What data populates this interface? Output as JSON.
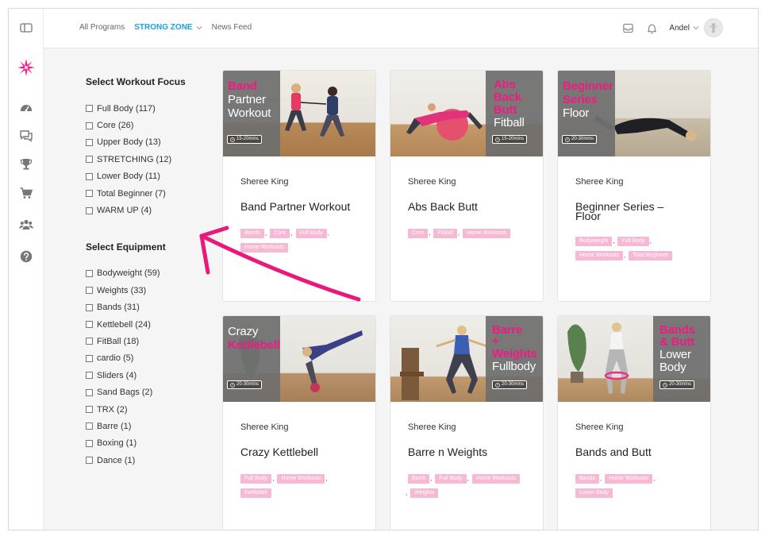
{
  "nav": {
    "all_programs": "All Programs",
    "strong_zone": "STRONG ZONE",
    "news_feed": "News Feed",
    "user_name": "Andel"
  },
  "sidebar": {
    "icons": [
      "sidebar-toggle-icon",
      "brand-logo",
      "dashboard-icon",
      "chat-icon",
      "trophy-icon",
      "cart-icon",
      "group-icon",
      "help-icon"
    ]
  },
  "filters": {
    "focus_title": "Select Workout Focus",
    "focus": [
      "Full Body (117)",
      "Core (26)",
      "Upper Body (13)",
      "STRETCHING (12)",
      "Lower Body (11)",
      "Total Beginner (7)",
      "WARM UP (4)"
    ],
    "equipment_title": "Select Equipment",
    "equipment": [
      "Bodyweight (59)",
      "Weights (33)",
      "Bands (31)",
      "Kettlebell (24)",
      "FitBall (18)",
      "cardio (5)",
      "Sliders (4)",
      "Sand Bags (2)",
      "TRX (2)",
      "Barre (1)",
      "Boxing (1)",
      "Dance (1)"
    ]
  },
  "cards": [
    {
      "author": "Sheree King",
      "title": "Band Partner Workout",
      "thumb_lines": [
        "Band",
        "Partner",
        "Workout"
      ],
      "duration": "15-20mins",
      "tags": [
        "Bands",
        "Core",
        "Full Body",
        "Home Workouts"
      ]
    },
    {
      "author": "Sheree King",
      "title": "Abs Back Butt",
      "thumb_lines": [
        "Abs",
        "Back",
        "Butt",
        "Fitball"
      ],
      "duration": "15-20mins",
      "tags": [
        "Core",
        "FitBall",
        "Home Workouts"
      ]
    },
    {
      "author": "Sheree King",
      "title": "Beginner Series – Floor",
      "thumb_lines": [
        "Beginner",
        "Series",
        "Floor"
      ],
      "duration": "20-30mins",
      "tags": [
        "Bodyweight",
        "Full Body",
        "Home Workouts",
        "Total Beginner"
      ]
    },
    {
      "author": "Sheree King",
      "title": "Crazy Kettlebell",
      "thumb_lines": [
        "Crazy",
        "Kettlebell"
      ],
      "duration": "20-30mins",
      "tags": [
        "Full Body",
        "Home Workouts",
        "Kettlebell"
      ]
    },
    {
      "author": "Sheree King",
      "title": "Barre n Weights",
      "thumb_lines": [
        "Barre",
        "+",
        "Weights",
        "Fullbody"
      ],
      "duration": "20-30mins",
      "tags": [
        "Barre",
        "Full Body",
        "Home Workouts",
        "Weights"
      ]
    },
    {
      "author": "Sheree King",
      "title": "Bands and Butt",
      "thumb_lines": [
        "Bands",
        "& Butt",
        "Lower",
        "Body"
      ],
      "duration": "20-30mins",
      "tags": [
        "Bands",
        "Home Workouts",
        "Lower Body"
      ]
    }
  ],
  "colors": {
    "accent_blue": "#1aa3d9",
    "brand_pink": "#ee1b82",
    "tag_pink": "#f7b8d3"
  }
}
